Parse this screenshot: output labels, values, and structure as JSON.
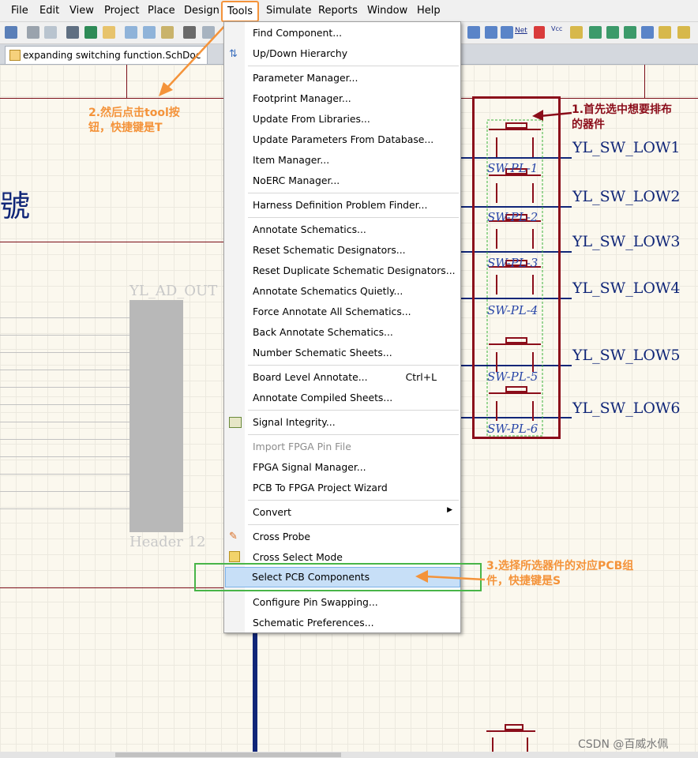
{
  "menubar": {
    "items": [
      "File",
      "Edit",
      "View",
      "Project",
      "Place",
      "Design",
      "Tools",
      "Simulate",
      "Reports",
      "Window",
      "Help"
    ],
    "active": "Tools"
  },
  "toolbar": {
    "net_label": "Net",
    "vcc_label": "Vcc"
  },
  "document_tab": {
    "title": "expanding switching function.SchDoc"
  },
  "tools_menu": {
    "items": [
      {
        "label": "Find Component...",
        "enabled": true
      },
      {
        "label": "Up/Down Hierarchy",
        "enabled": true
      },
      {
        "label": "Parameter Manager...",
        "enabled": true
      },
      {
        "label": "Footprint Manager...",
        "enabled": true
      },
      {
        "label": "Update From Libraries...",
        "enabled": true
      },
      {
        "label": "Update Parameters From Database...",
        "enabled": true
      },
      {
        "label": "Item Manager...",
        "enabled": true
      },
      {
        "label": "NoERC Manager...",
        "enabled": true
      },
      {
        "label": "Harness Definition Problem Finder...",
        "enabled": true
      },
      {
        "label": "Annotate Schematics...",
        "enabled": true
      },
      {
        "label": "Reset Schematic Designators...",
        "enabled": true
      },
      {
        "label": "Reset Duplicate Schematic Designators...",
        "enabled": true
      },
      {
        "label": "Annotate Schematics Quietly...",
        "enabled": true
      },
      {
        "label": "Force Annotate All Schematics...",
        "enabled": true
      },
      {
        "label": "Back Annotate Schematics...",
        "enabled": true
      },
      {
        "label": "Number Schematic Sheets...",
        "enabled": true
      },
      {
        "label": "Board Level Annotate...",
        "shortcut": "Ctrl+L",
        "enabled": true
      },
      {
        "label": "Annotate Compiled Sheets...",
        "enabled": true
      },
      {
        "label": "Signal Integrity...",
        "enabled": true
      },
      {
        "label": "Import FPGA Pin File",
        "enabled": false
      },
      {
        "label": "FPGA Signal Manager...",
        "enabled": true
      },
      {
        "label": "PCB To FPGA Project Wizard",
        "enabled": true
      },
      {
        "label": "Convert",
        "enabled": true,
        "submenu": true
      },
      {
        "label": "Cross Probe",
        "enabled": true
      },
      {
        "label": "Cross Select Mode",
        "enabled": true
      },
      {
        "label": "Select PCB Components",
        "enabled": true,
        "highlighted": true
      },
      {
        "label": "Configure Pin Swapping...",
        "enabled": true
      },
      {
        "label": "Schematic Preferences...",
        "enabled": true
      }
    ]
  },
  "schematic": {
    "partial_title_char": "號",
    "header_label": "YL_AD_OUT",
    "header_name": "Header 12",
    "net_labels": [
      "YL_SW_LOW1",
      "YL_SW_LOW2",
      "YL_SW_LOW3",
      "YL_SW_LOW4",
      "YL_SW_LOW5",
      "YL_SW_LOW6"
    ],
    "designators": [
      "SW-PL-1",
      "SW-PL-2",
      "SW-PL-3",
      "SW-PL-4",
      "SW-PL-5",
      "SW-PL-6"
    ]
  },
  "annotations": {
    "step1": "1.首先选中想要排布的器件",
    "step2": "2.然后点击tool按钮，快捷键是T",
    "step3": "3.选择所选器件的对应PCB组件，快捷键是S"
  },
  "watermark": "CSDN @百威水佩",
  "colors": {
    "menu_highlight": "#c7dff7",
    "annotation_orange": "#f4933a",
    "annotation_red": "#8b0d1a",
    "annotation_green": "#48b548",
    "net_blue": "#102678"
  }
}
